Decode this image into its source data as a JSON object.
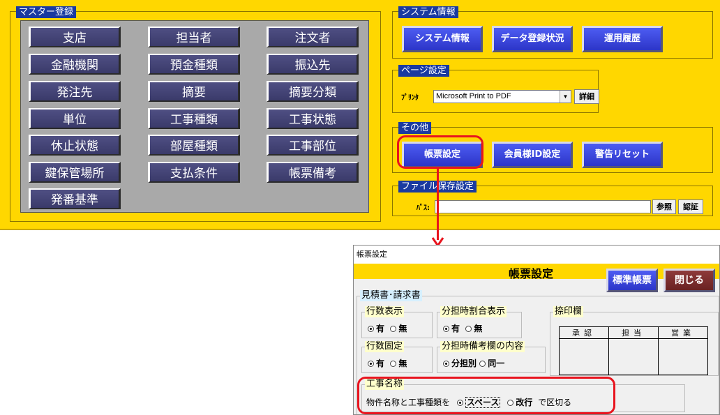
{
  "master": {
    "title": "マスター登録",
    "buttons": [
      "支店",
      "担当者",
      "注文者",
      "金融機関",
      "預金種類",
      "振込先",
      "発注先",
      "摘要",
      "摘要分類",
      "単位",
      "工事種類",
      "工事状態",
      "休止状態",
      "部屋種類",
      "工事部位",
      "鍵保管場所",
      "支払条件",
      "帳票備考",
      "発番基準"
    ]
  },
  "system": {
    "title": "システム情報",
    "buttons": [
      "システム情報",
      "データ登録状況",
      "運用履歴"
    ]
  },
  "page_setup": {
    "title": "ページ設定",
    "printer_label": "ﾌﾟﾘﾝﾀ",
    "printer_value": "Microsoft Print to PDF",
    "detail_button": "詳細"
  },
  "other": {
    "title": "その他",
    "buttons": [
      "帳票設定",
      "会員様ID設定",
      "警告リセット"
    ]
  },
  "file_save": {
    "title": "ファイル保存設定",
    "path_label": "ﾊﾟｽ:",
    "path_value": "",
    "browse_button": "参照",
    "auth_button": "認証"
  },
  "popup": {
    "window_title": "帳票設定",
    "heading": "帳票設定",
    "standard_button": "標準帳票",
    "close_button": "閉じる",
    "section_title": "見積書･請求書",
    "rows_display": {
      "title": "行数表示",
      "options": [
        "有",
        "無"
      ],
      "selected": "有"
    },
    "split_ratio": {
      "title": "分担時割合表示",
      "options": [
        "有",
        "無"
      ],
      "selected": "有"
    },
    "rows_fixed": {
      "title": "行数固定",
      "options": [
        "有",
        "無"
      ],
      "selected": "有"
    },
    "split_note": {
      "title": "分担時備考欄の内容",
      "options": [
        "分担別",
        "同一"
      ],
      "selected": "分担別"
    },
    "stamp": {
      "title": "捺印欄",
      "headers": [
        "承認",
        "担当",
        "営業"
      ]
    },
    "work_name": {
      "title": "工事名称",
      "prefix": "物件名称と工事種類を",
      "options": [
        "スペース",
        "改行"
      ],
      "selected": "スペース",
      "suffix": "で区切る"
    }
  },
  "colors": {
    "form_yellow": "#ffd700",
    "master_button": "#3f3f70",
    "blue_button": "#2c35c8",
    "close_button": "#7a2e2e",
    "highlight_red": "#e8141e"
  }
}
